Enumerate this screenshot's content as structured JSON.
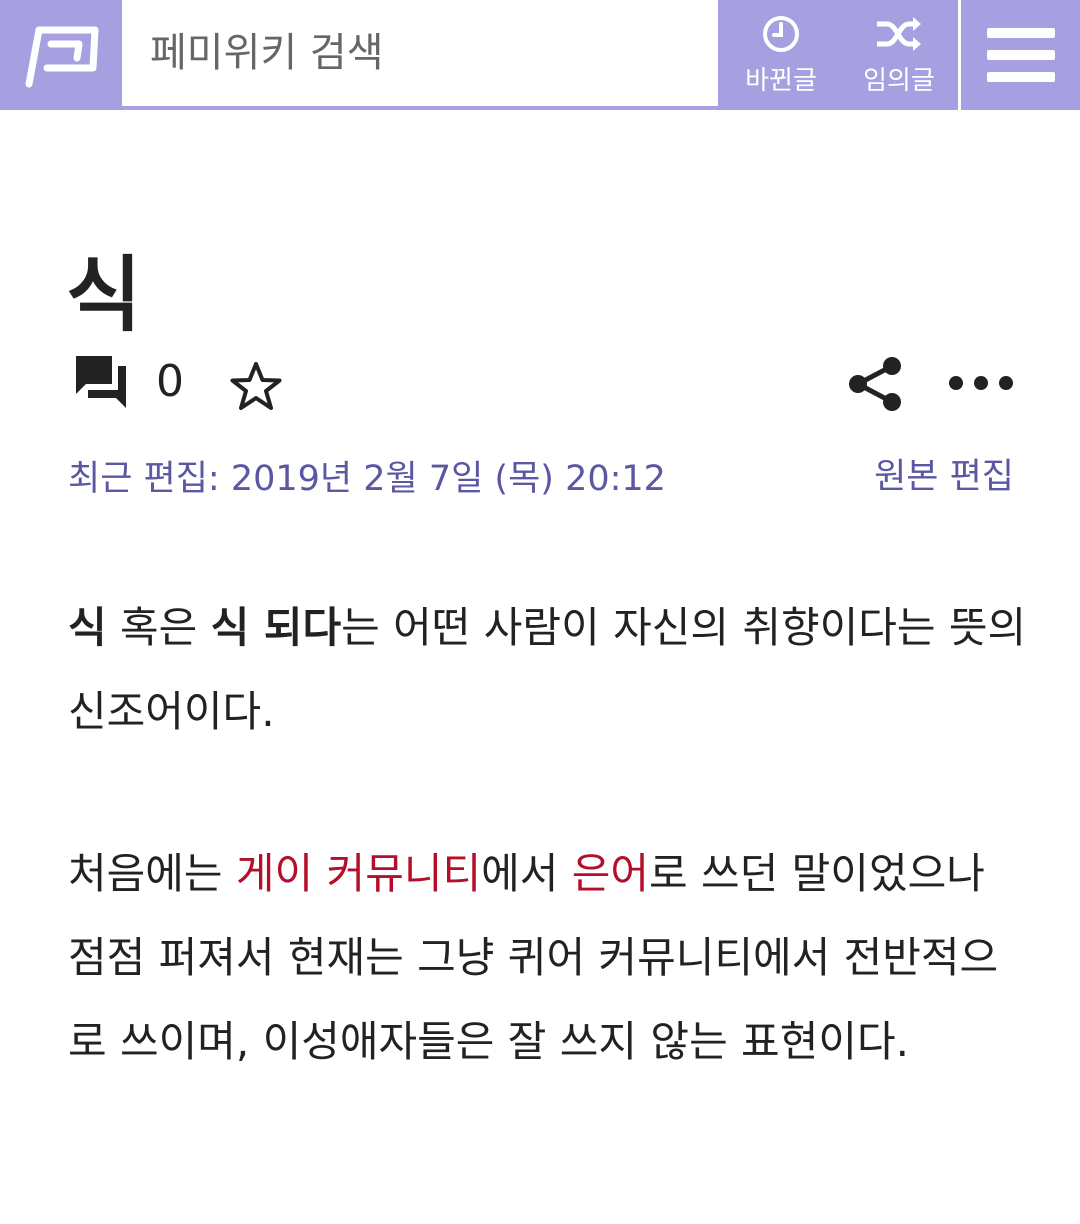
{
  "header": {
    "search_placeholder": "페미위키 검색",
    "recent_label": "바뀐글",
    "random_label": "임의글",
    "bar_color": "#a7a0e0"
  },
  "article": {
    "title": "식",
    "comment_count": "0",
    "last_edit": "최근 편집: 2019년 2월 7일 (목) 20:12",
    "edit_source": "원본 편집",
    "p1": {
      "term1": "식",
      "text1": " 혹은 ",
      "term2": "식 되다",
      "text2": "는 어떤 사람이 자신의 취향이다는 뜻의 신조어이다."
    },
    "p2": {
      "text1": "처음에는 ",
      "link1": "게이 커뮤니티",
      "text2": "에서 ",
      "link2": "은어",
      "text3": "로 쓰던 말이었으나 점점 퍼져서 현재는 그냥 퀴어 커뮤니티에서 전반적으로 쓰이며, 이성애자들은 잘 쓰지 않는 표현이다."
    },
    "link_color": "#b30f2a",
    "meta_color": "#5b57a2"
  },
  "icons": {
    "logo": "femiwiki-flag-logo",
    "recent": "clock-icon",
    "random": "shuffle-icon",
    "menu": "hamburger-menu-icon",
    "comments": "comments-icon",
    "star": "star-outline-icon",
    "share": "share-icon",
    "more": "more-dots-icon"
  }
}
